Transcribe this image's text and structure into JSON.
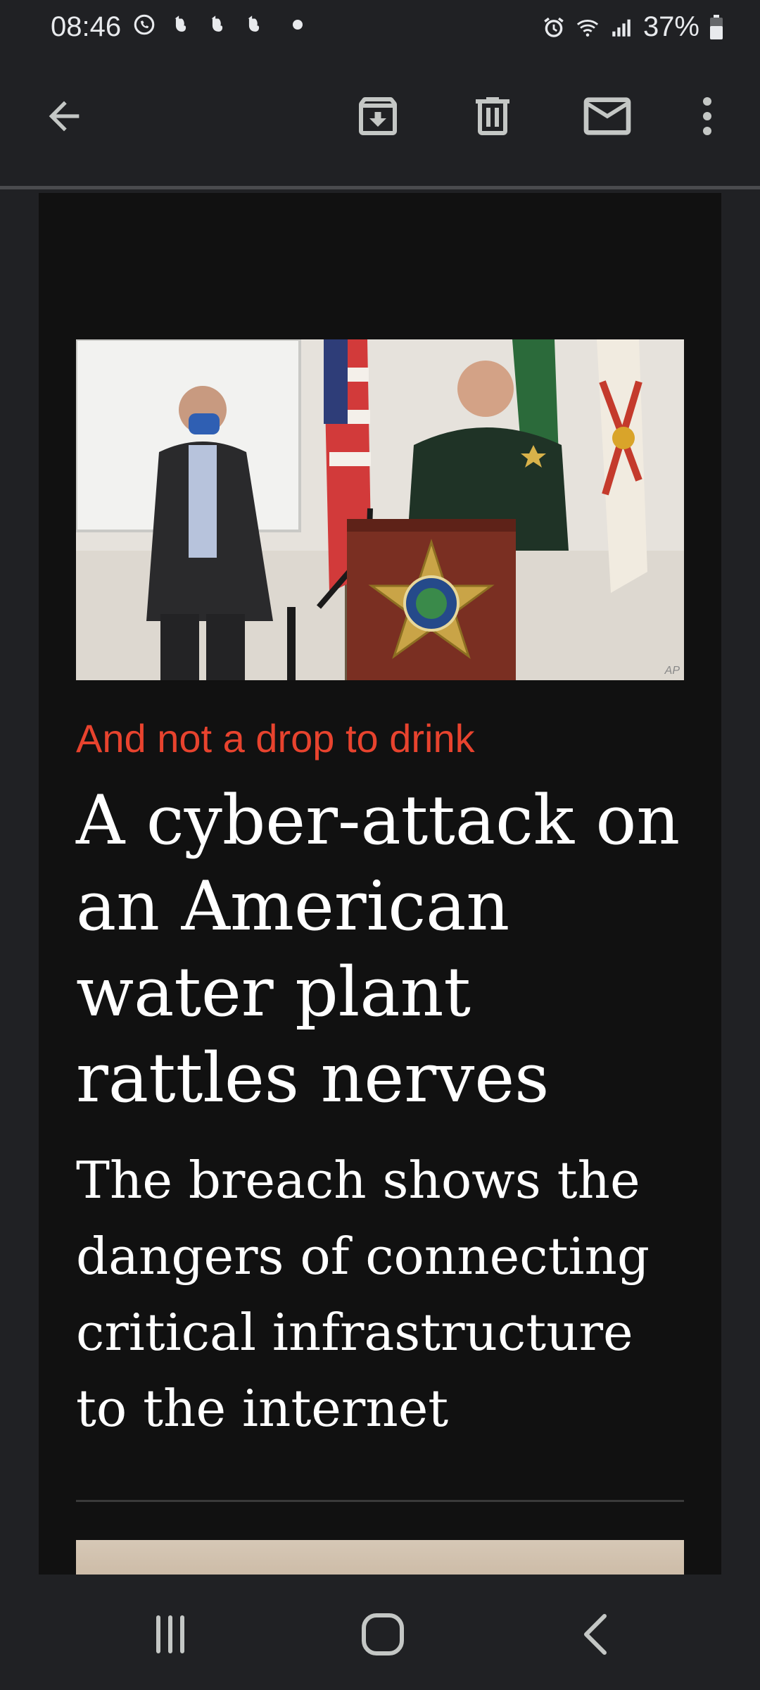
{
  "status_bar": {
    "time": "08:46",
    "battery_text": "37%",
    "left_icons": [
      "whatsapp-icon",
      "evernote-icon",
      "evernote-icon",
      "evernote-icon",
      "dot-icon"
    ],
    "right_icons": [
      "alarm-icon",
      "wifi-icon",
      "signal-icon",
      "battery-icon"
    ]
  },
  "toolbar": {
    "icons": [
      "back-arrow-icon",
      "archive-icon",
      "delete-icon",
      "mark-unread-icon",
      "more-vert-icon"
    ]
  },
  "article": {
    "image_credit": "AP",
    "rubric": "And not a drop to drink",
    "headline": "A cyber-attack on an American water plant rattles nerves",
    "standfirst": "The breach shows the dangers of connecting critical infrastructure to the internet",
    "accent_color": "#e8432e"
  },
  "nav_bar": {
    "icons": [
      "recent-apps-icon",
      "home-icon",
      "back-icon"
    ]
  }
}
